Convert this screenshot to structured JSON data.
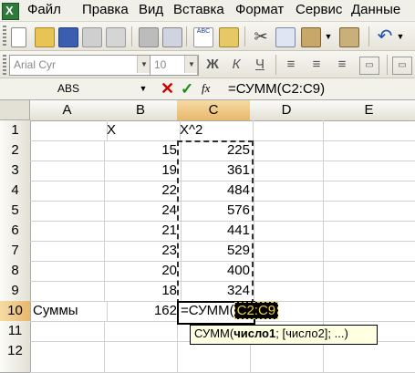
{
  "menu": {
    "items": [
      "Файл",
      "Правка",
      "Вид",
      "Вставка",
      "Формат",
      "Сервис",
      "Данные"
    ]
  },
  "toolbar": {
    "font_name": "Arial Cyr",
    "font_size": "10",
    "bold_label": "Ж",
    "italic_label": "К",
    "underline_label": "Ч"
  },
  "formula_bar": {
    "name_box": "ABS",
    "formula": "=СУММ(C2:C9)"
  },
  "columns": [
    "A",
    "B",
    "C",
    "D",
    "E"
  ],
  "rows": [
    "1",
    "2",
    "3",
    "4",
    "5",
    "6",
    "7",
    "8",
    "9",
    "10",
    "11",
    "12"
  ],
  "cells": {
    "B1": "X",
    "C1": "X^2",
    "B2": "15",
    "C2": "225",
    "B3": "19",
    "C3": "361",
    "B4": "22",
    "C4": "484",
    "B5": "24",
    "C5": "576",
    "B6": "21",
    "C6": "441",
    "B7": "23",
    "C7": "529",
    "B8": "20",
    "C8": "400",
    "B9": "18",
    "C9": "324",
    "A10": "Суммы",
    "B10": "162"
  },
  "edit": {
    "prefix": "=СУММ(",
    "ref": "C2:C9"
  },
  "tooltip": {
    "func": "СУММ(",
    "arg1": "число1",
    "rest": "; [число2]; ...)"
  },
  "colors": {
    "active_header": "#e8b76b",
    "cancel": "#cc0000",
    "enter": "#1a8a1a",
    "tooltip_bg": "#ffffe1"
  }
}
